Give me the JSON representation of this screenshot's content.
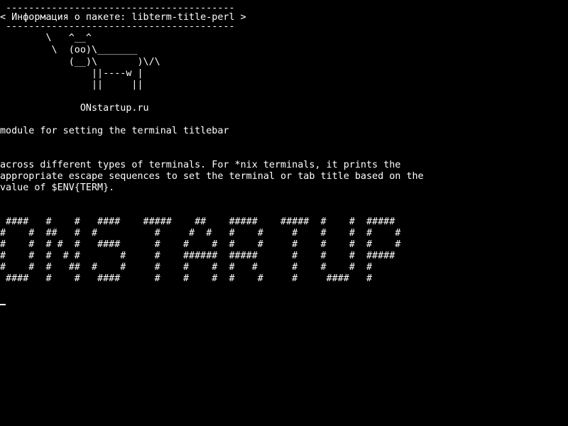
{
  "terminal": {
    "colors": {
      "background": "#000000",
      "foreground": "#ffffff"
    },
    "cowsay": {
      "border_top": " ----------------------------------------",
      "message": "< Информация о пакете: libterm-title-perl >",
      "border_bottom": " ----------------------------------------",
      "cow": [
        "        \\   ^__^",
        "         \\  (oo)\\_______",
        "            (__)\\       )\\/\\",
        "                ||----w |",
        "                ||     ||"
      ],
      "site": "              ONstartup.ru"
    },
    "summary": "module for setting the terminal titlebar",
    "description": [
      "across different types of terminals. For *nix terminals, it prints the",
      "appropriate escape sequences to set the terminal or tab title based on the",
      "value of $ENV{TERM}."
    ],
    "banner": [
      " ####   #    #   ####    #####    ##    #####    #####  #    #  #####",
      "#    #  ##   #  #          #     #  #   #    #     #    #    #  #    #",
      "#    #  # #  #   ####      #    #    #  #    #     #    #    #  #    #",
      "#    #  #  # #       #     #    ######  #####      #    #    #  #####",
      "#    #  #   ##  #    #     #    #    #  #   #      #    #    #  #",
      " ####   #    #   ####      #    #    #  #    #     #     ####   #"
    ]
  }
}
